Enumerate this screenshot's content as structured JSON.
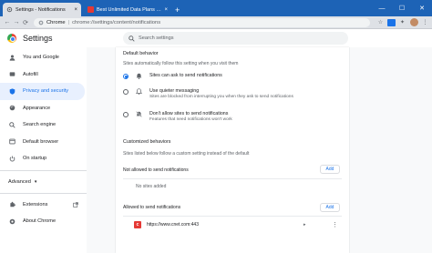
{
  "browser": {
    "tabs": [
      {
        "label": "Settings - Notifications",
        "close": "×",
        "active": true
      },
      {
        "label": "Best Unlimited Data Plans for 2021",
        "close": "×",
        "active": false
      }
    ],
    "new_tab": "+",
    "window_controls": [
      "—",
      "☐",
      "✕"
    ],
    "address": {
      "host": "Chrome",
      "separator": "|",
      "path": "chrome://settings/content/notifications"
    },
    "nav": {
      "back": "←",
      "forward": "→",
      "reload": "⟳"
    }
  },
  "header": {
    "title": "Settings",
    "search_placeholder": "Search settings"
  },
  "sidebar": {
    "items": [
      {
        "label": "You and Google",
        "icon": "person-icon"
      },
      {
        "label": "Autofill",
        "icon": "autofill-icon"
      },
      {
        "label": "Privacy and security",
        "icon": "shield-icon",
        "active": true
      },
      {
        "label": "Appearance",
        "icon": "palette-icon"
      },
      {
        "label": "Search engine",
        "icon": "search-icon"
      },
      {
        "label": "Default browser",
        "icon": "browser-icon"
      },
      {
        "label": "On startup",
        "icon": "power-icon"
      }
    ],
    "advanced": "Advanced",
    "advanced_chevron": "▾",
    "bottom": [
      {
        "label": "Extensions",
        "icon": "puzzle-icon"
      },
      {
        "label": "About Chrome",
        "icon": "chrome-icon"
      }
    ]
  },
  "main": {
    "default_behavior": {
      "title": "Default behavior",
      "subtitle": "Sites automatically follow this setting when you visit them",
      "options": [
        {
          "label": "Sites can ask to send notifications",
          "desc": "",
          "checked": true
        },
        {
          "label": "Use quieter messaging",
          "desc": "Sites are blocked from interrupting you when they ask to send notifications",
          "checked": false
        },
        {
          "label": "Don't allow sites to send notifications",
          "desc": "Features that need notifications won't work",
          "checked": false
        }
      ]
    },
    "customized": {
      "title": "Customized behaviors",
      "subtitle": "Sites listed below follow a custom setting instead of the default"
    },
    "not_allowed": {
      "title": "Not allowed to send notifications",
      "add_label": "Add",
      "empty_text": "No sites added"
    },
    "allowed": {
      "title": "Allowed to send notifications",
      "add_label": "Add",
      "sites": [
        {
          "favicon_letter": "c",
          "url": "https://www.cnet.com:443",
          "expand": "▸",
          "more": "⋮"
        }
      ]
    }
  },
  "colors": {
    "titlebar": "#1d63b6",
    "accent": "#1a73e8",
    "active_nav_bg": "#e8f0fe"
  }
}
